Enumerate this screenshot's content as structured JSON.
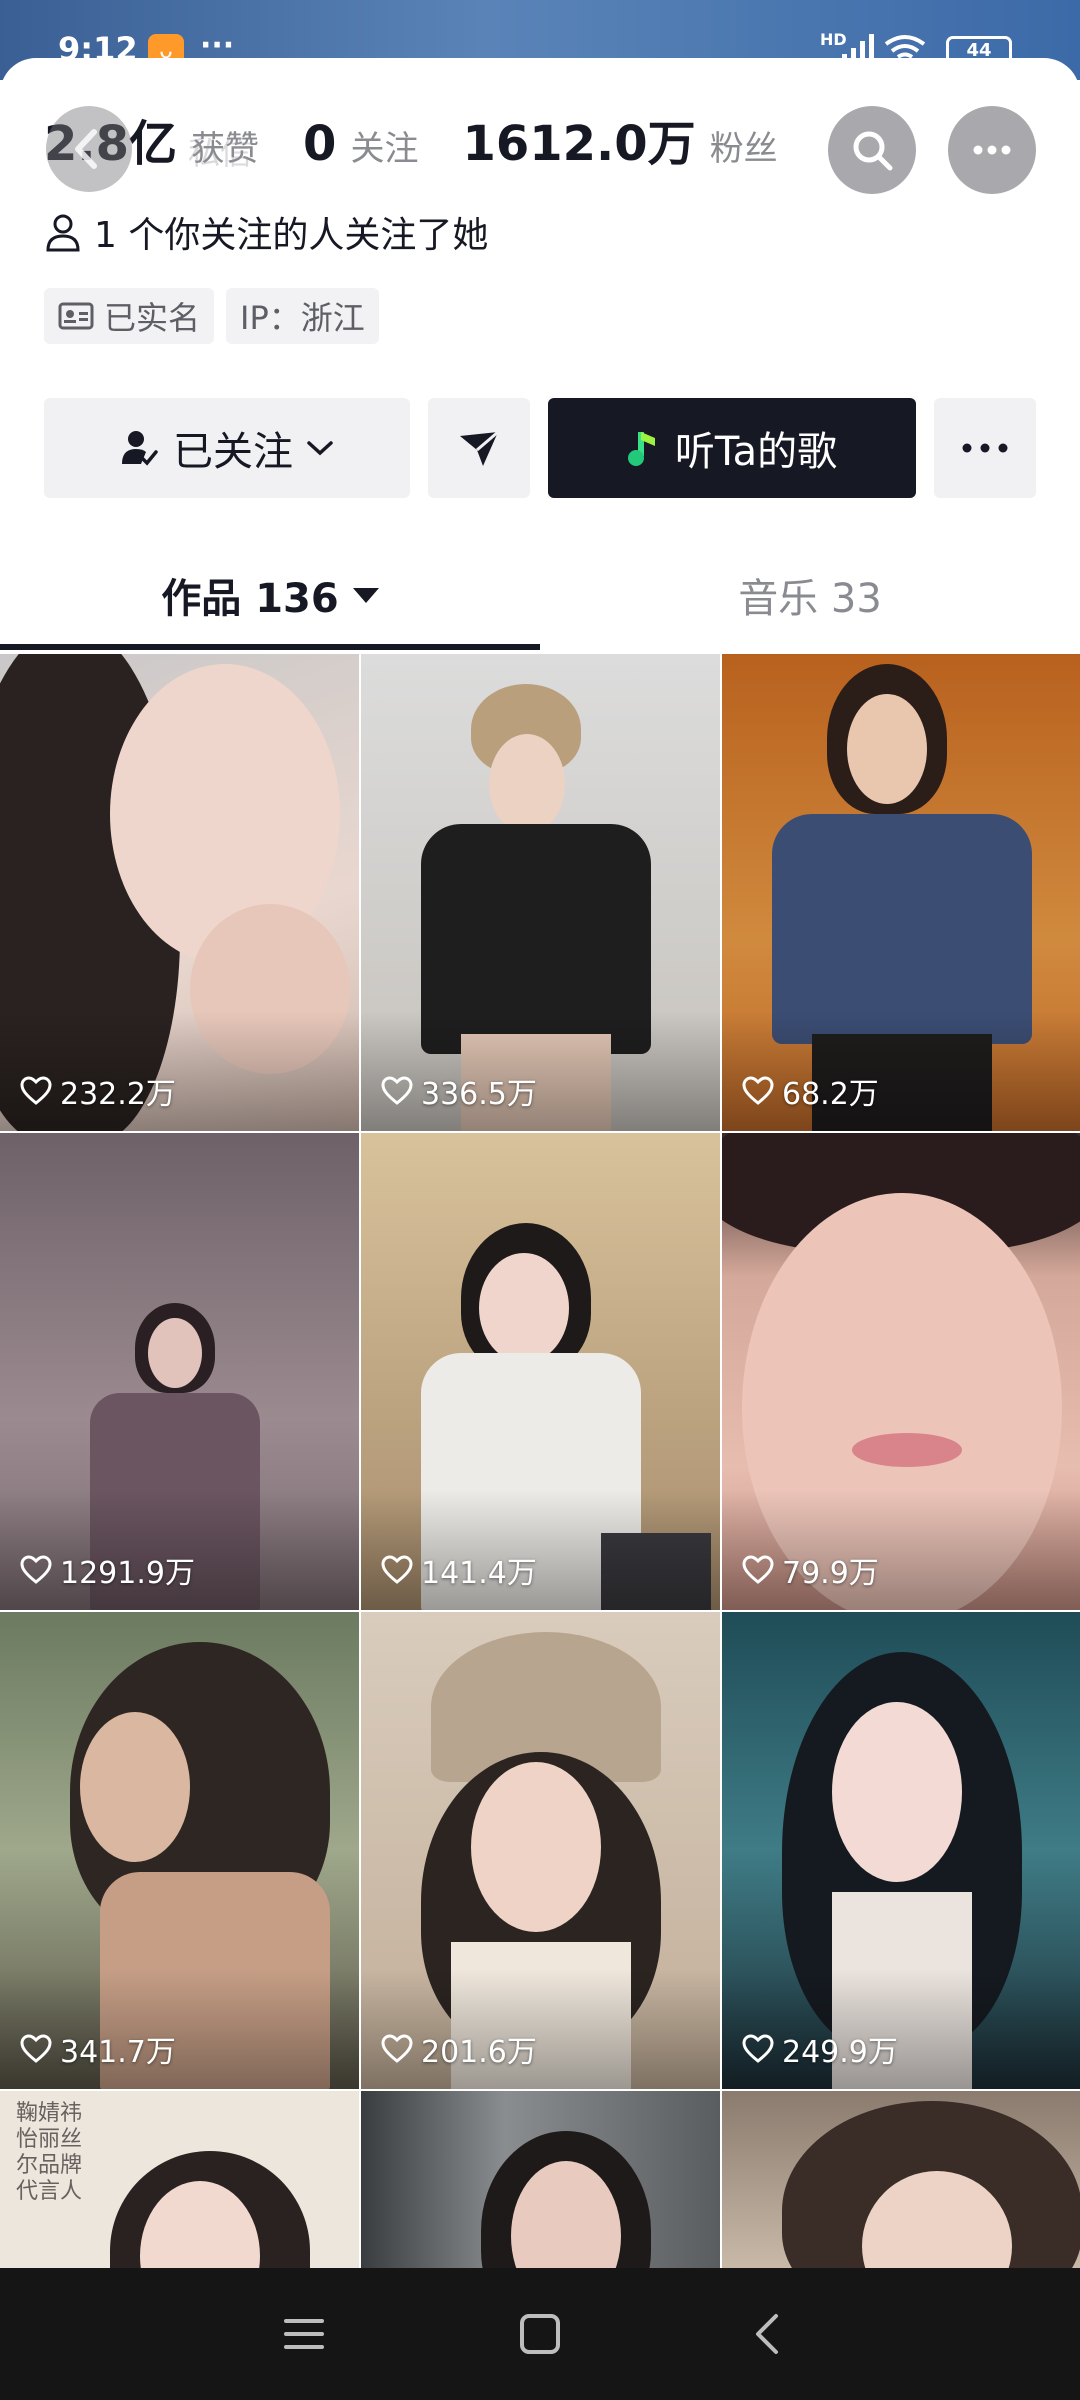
{
  "status": {
    "time": "9:12",
    "app_badge": "ᴗ",
    "dots": "···",
    "hd": "HD",
    "battery": "44"
  },
  "overlay": {
    "ghost_label": "私信"
  },
  "stats": [
    {
      "value": "2.8亿",
      "label": "获赞"
    },
    {
      "value": "0",
      "label": "关注"
    },
    {
      "value": "1612.0万",
      "label": "粉丝"
    }
  ],
  "mutual": "1 个你关注的人关注了她",
  "tags": [
    "已实名",
    "IP：浙江"
  ],
  "actions": {
    "follow": "已关注",
    "song": "听Ta的歌"
  },
  "tabs": {
    "works": "作品 136",
    "music": "音乐 33"
  },
  "grid": [
    {
      "likes": "232.2万",
      "bg": "#d9c9c4"
    },
    {
      "likes": "336.5万",
      "bg": "#cfcac4"
    },
    {
      "likes": "68.2万",
      "bg": "#c9772c"
    },
    {
      "likes": "1291.9万",
      "bg": "#8d7a80"
    },
    {
      "likes": "141.4万",
      "bg": "#b79a78"
    },
    {
      "likes": "79.9万",
      "bg": "#c79a90"
    },
    {
      "likes": "341.7万",
      "bg": "#7e8a6e"
    },
    {
      "likes": "201.6万",
      "bg": "#cfc0ae"
    },
    {
      "likes": "249.9万",
      "bg": "#2e5f6a"
    },
    {
      "likes": "",
      "bg": "#e8e2d8"
    },
    {
      "likes": "",
      "bg": "#4f5254"
    },
    {
      "likes": "",
      "bg": "#6b5d52"
    }
  ],
  "poster_text": "鞠婧祎\n怡丽丝尔品牌代言人",
  "colors": {
    "dark_button": "#161823",
    "gray_button": "#f1f1f3",
    "muted_text": "#8a8b91"
  }
}
